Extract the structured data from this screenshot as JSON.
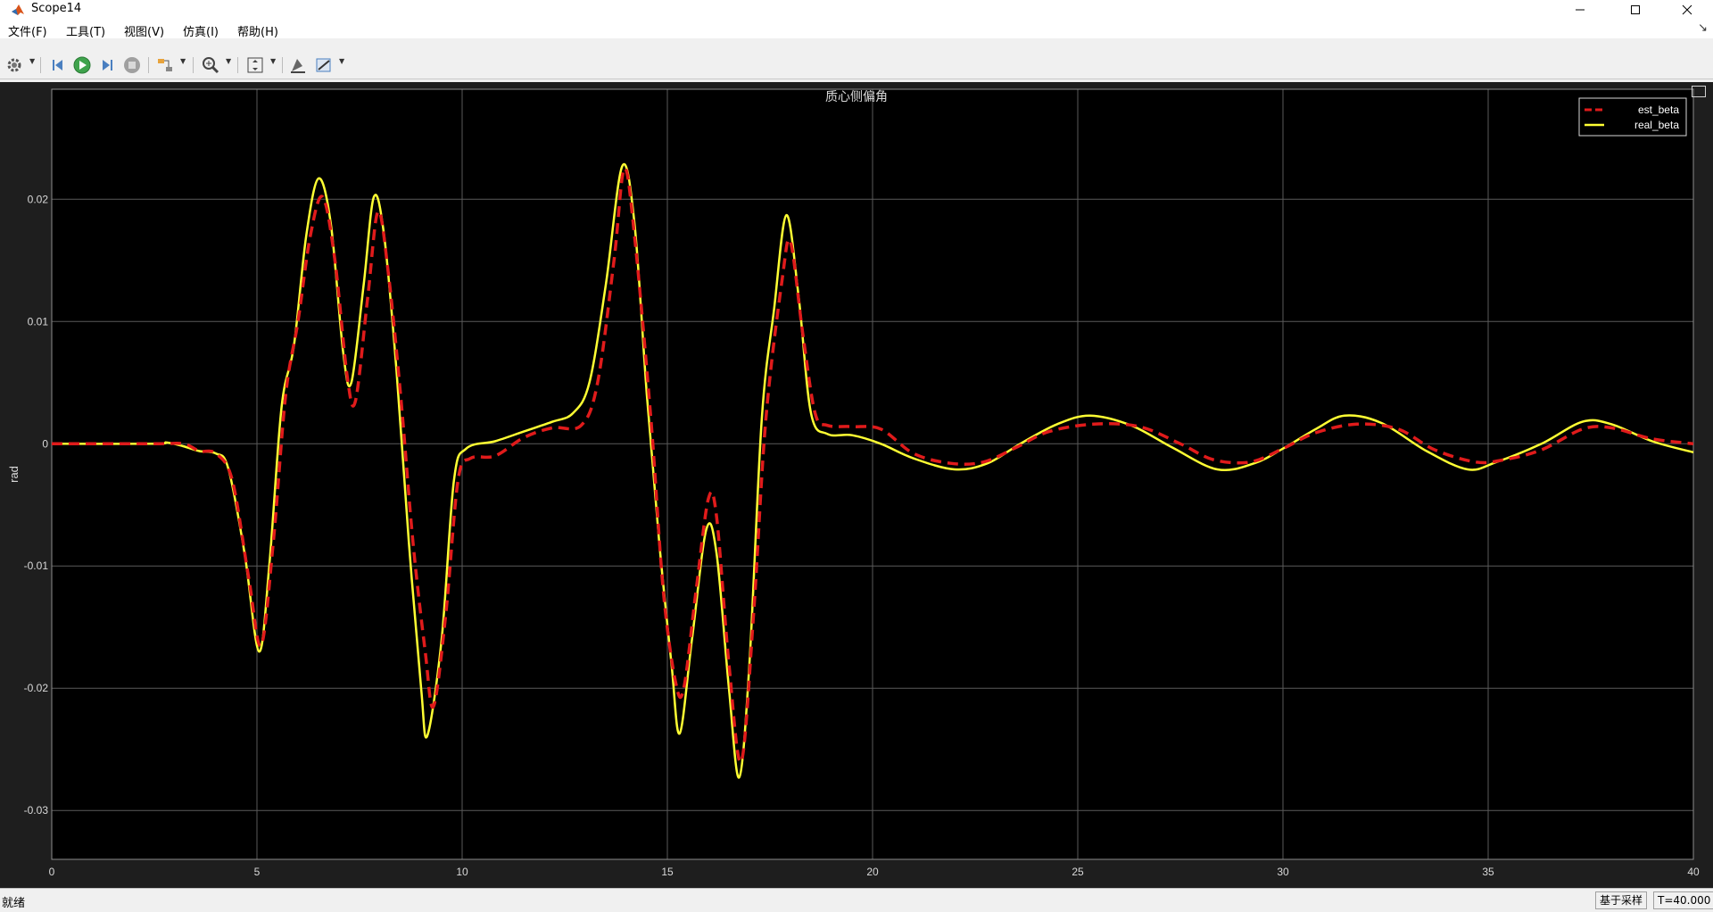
{
  "window": {
    "title": "Scope14"
  },
  "menu": [
    "文件(F)",
    "工具(T)",
    "视图(V)",
    "仿真(I)",
    "帮助(H)"
  ],
  "toolbar": {
    "icons": [
      "gear-icon",
      "step-back-icon",
      "run-icon",
      "step-forward-icon",
      "stop-icon",
      "highlight-block-icon",
      "zoom-icon",
      "scale-axes-icon",
      "cursor-measurement-icon",
      "style-icon"
    ]
  },
  "plot": {
    "title": "质心侧偏角",
    "legend": [
      "est_beta",
      "real_beta"
    ]
  },
  "chart_data": {
    "type": "line",
    "title": "质心侧偏角",
    "xlabel": "",
    "ylabel": "rad",
    "xlim": [
      0,
      40
    ],
    "ylim": [
      -0.034,
      0.029
    ],
    "x_ticks": [
      "0",
      "5",
      "10",
      "15",
      "20",
      "25",
      "30",
      "35",
      "40"
    ],
    "y_ticks": [
      "0.02",
      "0.01",
      "0",
      "-0.01",
      "-0.02",
      "-0.03"
    ],
    "grid": true,
    "legend_position": "top-right",
    "series": [
      {
        "name": "est_beta",
        "color": "#e01b1b",
        "style": "dashed",
        "points": [
          [
            0,
            0
          ],
          [
            2.5,
            0
          ],
          [
            3.2,
            0
          ],
          [
            3.6,
            -0.0006
          ],
          [
            4.0,
            -0.0008
          ],
          [
            4.4,
            -0.003
          ],
          [
            4.8,
            -0.011
          ],
          [
            5.1,
            -0.0165
          ],
          [
            5.4,
            -0.008
          ],
          [
            5.7,
            0.004
          ],
          [
            6.0,
            0.01
          ],
          [
            6.3,
            0.017
          ],
          [
            6.6,
            0.0202
          ],
          [
            6.9,
            0.015
          ],
          [
            7.2,
            0.0055
          ],
          [
            7.4,
            0.0035
          ],
          [
            7.7,
            0.012
          ],
          [
            7.95,
            0.019
          ],
          [
            8.2,
            0.014
          ],
          [
            8.5,
            0.004
          ],
          [
            8.8,
            -0.008
          ],
          [
            9.1,
            -0.017
          ],
          [
            9.3,
            -0.0215
          ],
          [
            9.6,
            -0.014
          ],
          [
            9.9,
            -0.003
          ],
          [
            10.2,
            -0.0012
          ],
          [
            10.8,
            -0.001
          ],
          [
            11.5,
            0.0005
          ],
          [
            12.2,
            0.0013
          ],
          [
            12.9,
            0.0015
          ],
          [
            13.3,
            0.005
          ],
          [
            13.7,
            0.015
          ],
          [
            13.95,
            0.0225
          ],
          [
            14.2,
            0.017
          ],
          [
            14.6,
            0.002
          ],
          [
            14.9,
            -0.012
          ],
          [
            15.2,
            -0.0195
          ],
          [
            15.4,
            -0.02
          ],
          [
            15.7,
            -0.012
          ],
          [
            16.0,
            -0.0045
          ],
          [
            16.2,
            -0.006
          ],
          [
            16.5,
            -0.018
          ],
          [
            16.8,
            -0.026
          ],
          [
            17.1,
            -0.014
          ],
          [
            17.4,
            0.002
          ],
          [
            17.8,
            0.0135
          ],
          [
            18.0,
            0.0165
          ],
          [
            18.3,
            0.009
          ],
          [
            18.6,
            0.0025
          ],
          [
            18.9,
            0.0015
          ],
          [
            19.5,
            0.0014
          ],
          [
            20.2,
            0.0012
          ],
          [
            21.0,
            -0.0008
          ],
          [
            21.9,
            -0.0016
          ],
          [
            22.7,
            -0.0015
          ],
          [
            23.5,
            -0.0003
          ],
          [
            24.3,
            0.001
          ],
          [
            25.4,
            0.0016
          ],
          [
            26.5,
            0.0014
          ],
          [
            27.5,
            0.0
          ],
          [
            28.3,
            -0.0013
          ],
          [
            29.2,
            -0.0015
          ],
          [
            30.0,
            -0.0004
          ],
          [
            30.8,
            0.0009
          ],
          [
            31.8,
            0.0016
          ],
          [
            32.8,
            0.0012
          ],
          [
            33.7,
            -0.0005
          ],
          [
            34.7,
            -0.0015
          ],
          [
            35.4,
            -0.0013
          ],
          [
            36.3,
            -0.0005
          ],
          [
            37.3,
            0.0012
          ],
          [
            38.0,
            0.0013
          ],
          [
            39.0,
            0.0004
          ],
          [
            40,
            0.0
          ]
        ]
      },
      {
        "name": "real_beta",
        "color": "#ffff33",
        "style": "solid",
        "points": [
          [
            0,
            0
          ],
          [
            2.5,
            0
          ],
          [
            2.8,
            0.0001
          ],
          [
            3.2,
            -0.0002
          ],
          [
            3.6,
            -0.0006
          ],
          [
            4.0,
            -0.0008
          ],
          [
            4.3,
            -0.002
          ],
          [
            4.7,
            -0.009
          ],
          [
            5.05,
            -0.017
          ],
          [
            5.3,
            -0.01
          ],
          [
            5.6,
            0.003
          ],
          [
            5.9,
            0.008
          ],
          [
            6.2,
            0.017
          ],
          [
            6.5,
            0.0217
          ],
          [
            6.8,
            0.018
          ],
          [
            7.1,
            0.0075
          ],
          [
            7.3,
            0.005
          ],
          [
            7.6,
            0.013
          ],
          [
            7.85,
            0.0202
          ],
          [
            8.1,
            0.017
          ],
          [
            8.4,
            0.006
          ],
          [
            8.7,
            -0.008
          ],
          [
            9.0,
            -0.02
          ],
          [
            9.15,
            -0.0239
          ],
          [
            9.5,
            -0.016
          ],
          [
            9.8,
            -0.003
          ],
          [
            10.1,
            -0.0004
          ],
          [
            10.8,
            0.0002
          ],
          [
            11.5,
            0.001
          ],
          [
            12.2,
            0.0018
          ],
          [
            12.7,
            0.0025
          ],
          [
            13.1,
            0.005
          ],
          [
            13.5,
            0.013
          ],
          [
            13.9,
            0.0227
          ],
          [
            14.2,
            0.018
          ],
          [
            14.5,
            0.004
          ],
          [
            14.8,
            -0.008
          ],
          [
            15.1,
            -0.018
          ],
          [
            15.3,
            -0.0237
          ],
          [
            15.6,
            -0.016
          ],
          [
            15.95,
            -0.007
          ],
          [
            16.2,
            -0.009
          ],
          [
            16.5,
            -0.02
          ],
          [
            16.75,
            -0.0273
          ],
          [
            17.0,
            -0.018
          ],
          [
            17.3,
            0.002
          ],
          [
            17.6,
            0.011
          ],
          [
            17.9,
            0.0187
          ],
          [
            18.2,
            0.012
          ],
          [
            18.5,
            0.0025
          ],
          [
            18.9,
            0.0008
          ],
          [
            19.5,
            0.0007
          ],
          [
            20.2,
            0.0
          ],
          [
            21.0,
            -0.0012
          ],
          [
            22.0,
            -0.0021
          ],
          [
            22.8,
            -0.0016
          ],
          [
            23.6,
            0.0
          ],
          [
            24.5,
            0.0016
          ],
          [
            25.3,
            0.0023
          ],
          [
            26.3,
            0.0015
          ],
          [
            27.3,
            -0.0003
          ],
          [
            28.4,
            -0.0021
          ],
          [
            29.3,
            -0.0016
          ],
          [
            30.0,
            -0.0004
          ],
          [
            30.8,
            0.0012
          ],
          [
            31.5,
            0.0023
          ],
          [
            32.4,
            0.0017
          ],
          [
            33.5,
            -0.0006
          ],
          [
            34.5,
            -0.0021
          ],
          [
            35.2,
            -0.0015
          ],
          [
            36.3,
            0.0
          ],
          [
            37.3,
            0.0018
          ],
          [
            38.0,
            0.0016
          ],
          [
            39.0,
            0.0002
          ],
          [
            40,
            -0.0007
          ]
        ]
      }
    ]
  },
  "status": {
    "text": "就绪",
    "sample": "基于采样",
    "time": "T=40.000"
  }
}
